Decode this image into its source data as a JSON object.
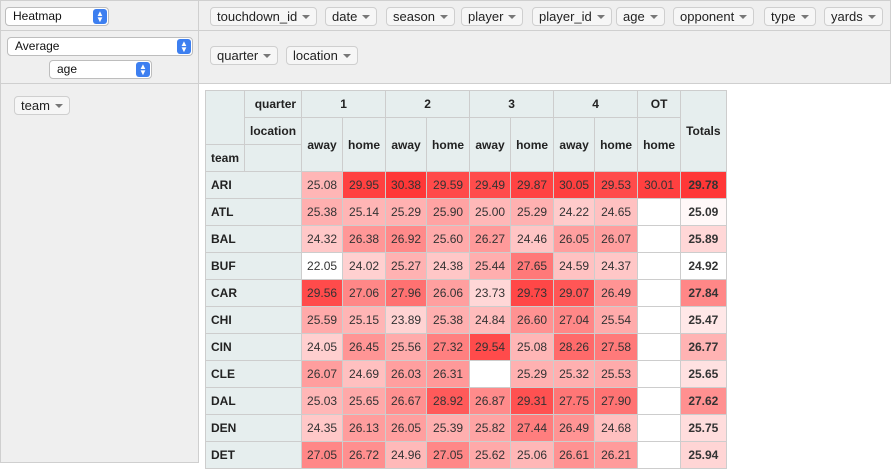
{
  "renderer": {
    "value": "Heatmap"
  },
  "aggregator": {
    "value": "Average",
    "attribute": "age"
  },
  "unused_attributes": [
    "touchdown_id",
    "date",
    "season",
    "player",
    "player_id",
    "age",
    "opponent",
    "type",
    "yards"
  ],
  "col_attributes": [
    "quarter",
    "location"
  ],
  "row_attributes": [
    "team"
  ],
  "table": {
    "col_axis_labels": [
      "quarter",
      "location"
    ],
    "row_axis_label": "team",
    "quarters": [
      "1",
      "2",
      "3",
      "4",
      "OT"
    ],
    "locations": [
      "away",
      "home",
      "away",
      "home",
      "away",
      "home",
      "away",
      "home",
      "home"
    ],
    "totals_label": "Totals",
    "rows": [
      {
        "team": "ARI",
        "values": [
          "25.08",
          "29.95",
          "30.38",
          "29.59",
          "29.49",
          "29.87",
          "30.05",
          "29.53",
          "30.01"
        ],
        "total": "29.78"
      },
      {
        "team": "ATL",
        "values": [
          "25.38",
          "25.14",
          "25.29",
          "25.90",
          "25.00",
          "25.29",
          "24.22",
          "24.65",
          ""
        ],
        "total": "25.09"
      },
      {
        "team": "BAL",
        "values": [
          "24.32",
          "26.38",
          "26.92",
          "25.60",
          "26.27",
          "24.46",
          "26.05",
          "26.07",
          ""
        ],
        "total": "25.89"
      },
      {
        "team": "BUF",
        "values": [
          "22.05",
          "24.02",
          "25.27",
          "24.38",
          "25.44",
          "27.65",
          "24.59",
          "24.37",
          ""
        ],
        "total": "24.92"
      },
      {
        "team": "CAR",
        "values": [
          "29.56",
          "27.06",
          "27.96",
          "26.06",
          "23.73",
          "29.73",
          "29.07",
          "26.49",
          ""
        ],
        "total": "27.84"
      },
      {
        "team": "CHI",
        "values": [
          "25.59",
          "25.15",
          "23.89",
          "25.38",
          "24.84",
          "26.60",
          "27.04",
          "25.54",
          ""
        ],
        "total": "25.47"
      },
      {
        "team": "CIN",
        "values": [
          "24.05",
          "26.45",
          "25.56",
          "27.32",
          "29.54",
          "25.08",
          "28.26",
          "27.58",
          ""
        ],
        "total": "26.77"
      },
      {
        "team": "CLE",
        "values": [
          "26.07",
          "24.69",
          "26.03",
          "26.31",
          "",
          "25.29",
          "25.32",
          "25.53",
          ""
        ],
        "total": "25.65"
      },
      {
        "team": "DAL",
        "values": [
          "25.03",
          "25.65",
          "26.67",
          "28.92",
          "26.87",
          "29.31",
          "27.75",
          "27.90",
          ""
        ],
        "total": "27.62"
      },
      {
        "team": "DEN",
        "values": [
          "24.35",
          "26.13",
          "26.05",
          "25.39",
          "25.82",
          "27.44",
          "26.49",
          "24.68",
          ""
        ],
        "total": "25.75"
      },
      {
        "team": "DET",
        "values": [
          "27.05",
          "26.72",
          "24.96",
          "27.05",
          "25.62",
          "25.06",
          "26.61",
          "26.21",
          ""
        ],
        "total": "25.94"
      }
    ]
  }
}
